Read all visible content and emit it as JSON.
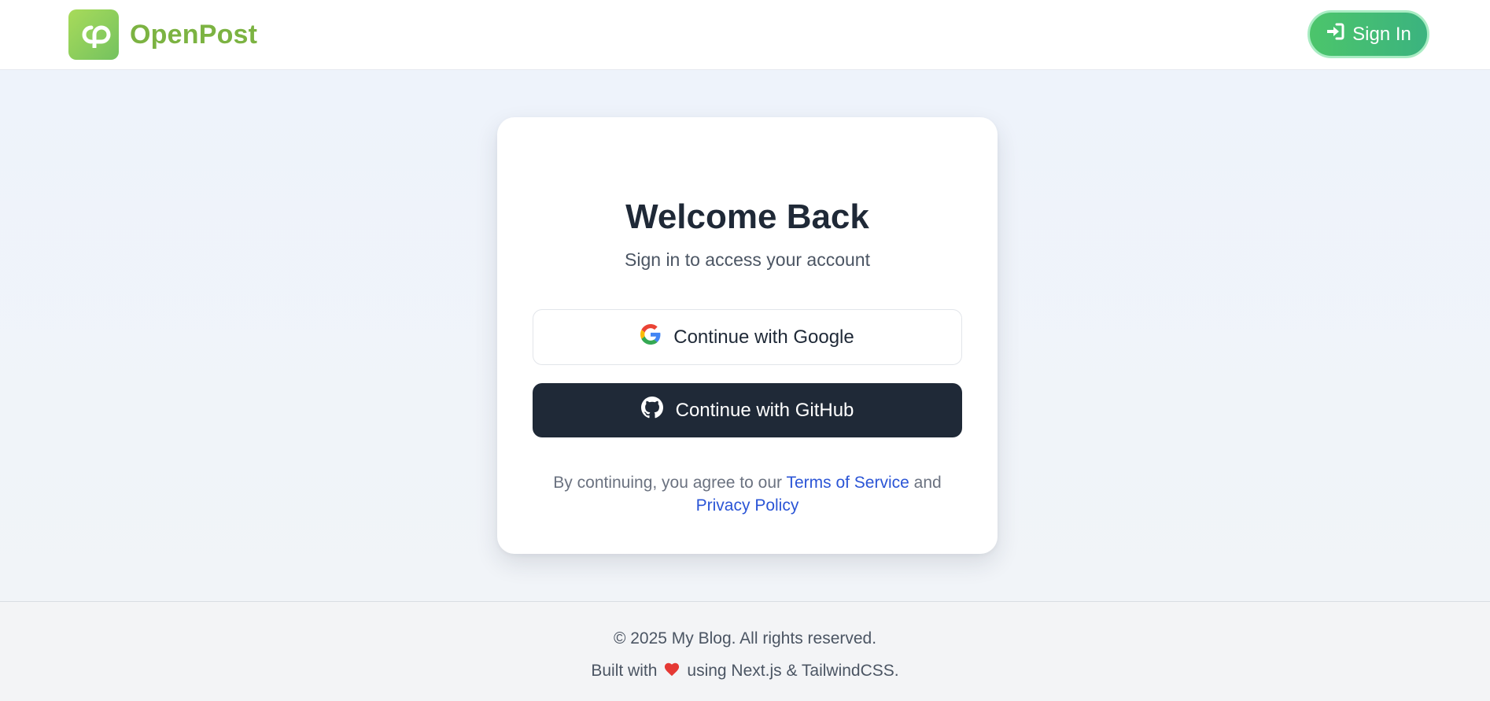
{
  "header": {
    "logo_initials": "cp",
    "brand_name": "OpenPost",
    "signin_label": "Sign In"
  },
  "card": {
    "title": "Welcome Back",
    "subtitle": "Sign in to access your account",
    "google_button": "Continue with Google",
    "github_button": "Continue with GitHub",
    "legal_prefix": "By continuing, you agree to our ",
    "terms_link": "Terms of Service",
    "legal_and": " and",
    "privacy_link": "Privacy Policy"
  },
  "footer": {
    "copyright": "© 2025 My Blog. All rights reserved.",
    "built_prefix": "Built with",
    "built_suffix": "using Next.js & TailwindCSS."
  },
  "colors": {
    "brand_green": "#7cb342",
    "signin_green": "#4cc56b",
    "dark_button": "#1f2937",
    "link_blue": "#2b55d6",
    "heart_red": "#e53935"
  },
  "icons": {
    "logo": "openpost-logo-icon",
    "signin": "sign-in-icon",
    "google": "google-icon",
    "github": "github-icon",
    "heart": "heart-icon"
  }
}
